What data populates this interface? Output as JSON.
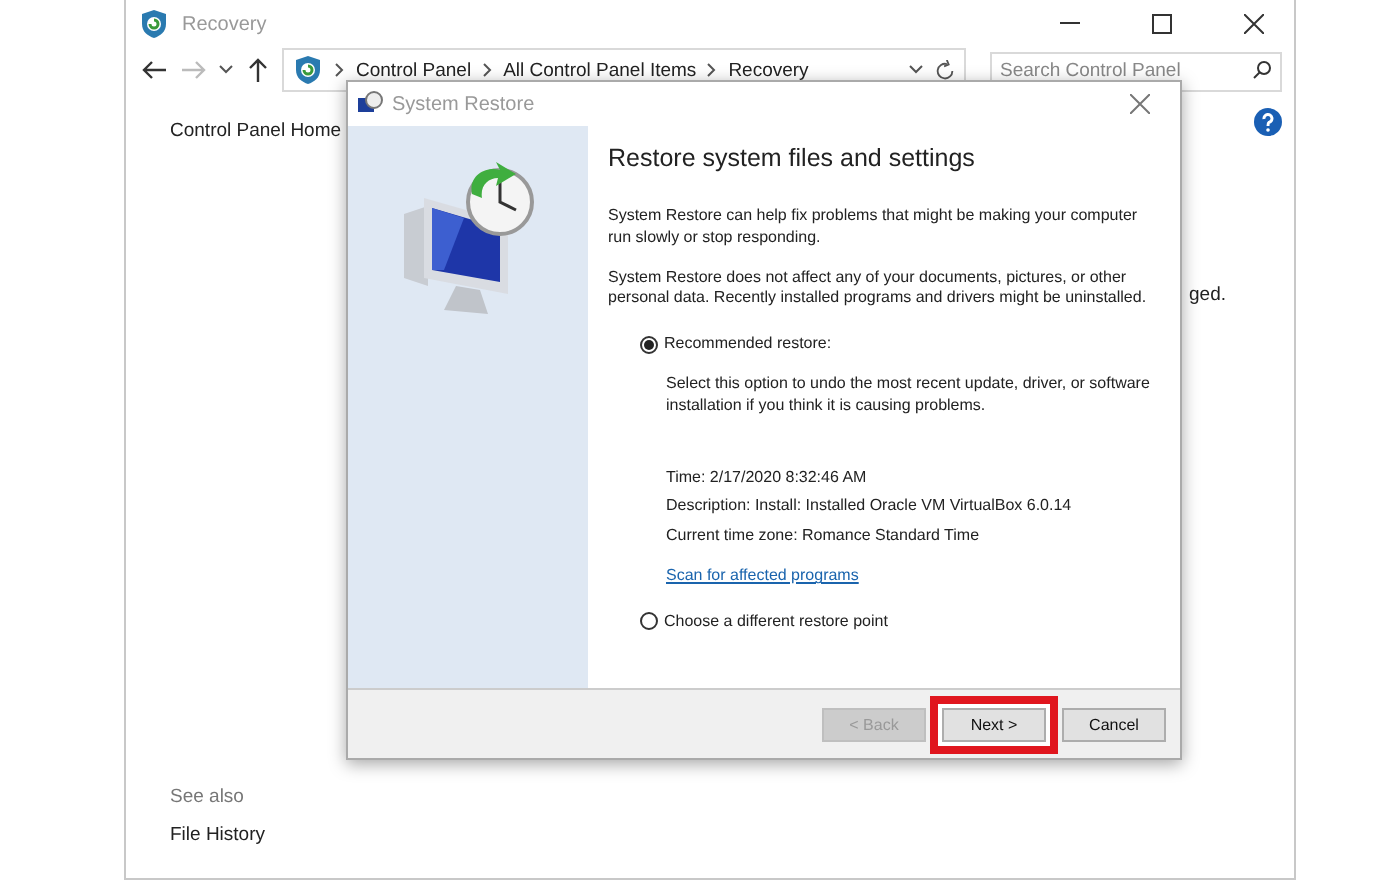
{
  "window": {
    "title": "Recovery"
  },
  "address_bar": {
    "path": [
      "Control Panel",
      "All Control Panel Items",
      "Recovery"
    ]
  },
  "search": {
    "placeholder": "Search Control Panel"
  },
  "sidebar": {
    "home_link": "Control Panel Home",
    "see_also": "See also",
    "links": [
      "File History"
    ]
  },
  "background_text": "ged.",
  "dialog": {
    "title": "System Restore",
    "heading": "Restore system files and settings",
    "paragraphs": [
      "System Restore can help fix problems that might be making your computer run slowly or stop responding.",
      "System Restore does not affect any of your documents, pictures, or other personal data. Recently installed programs and drivers might be uninstalled."
    ],
    "options": [
      {
        "label": "Recommended restore:",
        "selected": true,
        "description": "Select this option to undo the most recent update, driver, or software installation if you think it is causing problems.",
        "details": [
          "Time: 2/17/2020 8:32:46 AM",
          "Description: Install: Installed Oracle VM VirtualBox 6.0.14",
          "Current time zone: Romance Standard Time"
        ],
        "link": "Scan for affected programs"
      },
      {
        "label": "Choose a different restore point",
        "selected": false
      }
    ],
    "buttons": [
      {
        "label": "< Back",
        "disabled": true,
        "highlighted": false
      },
      {
        "label": "Next >",
        "disabled": false,
        "highlighted": true
      },
      {
        "label": "Cancel",
        "disabled": false,
        "highlighted": false
      }
    ]
  }
}
